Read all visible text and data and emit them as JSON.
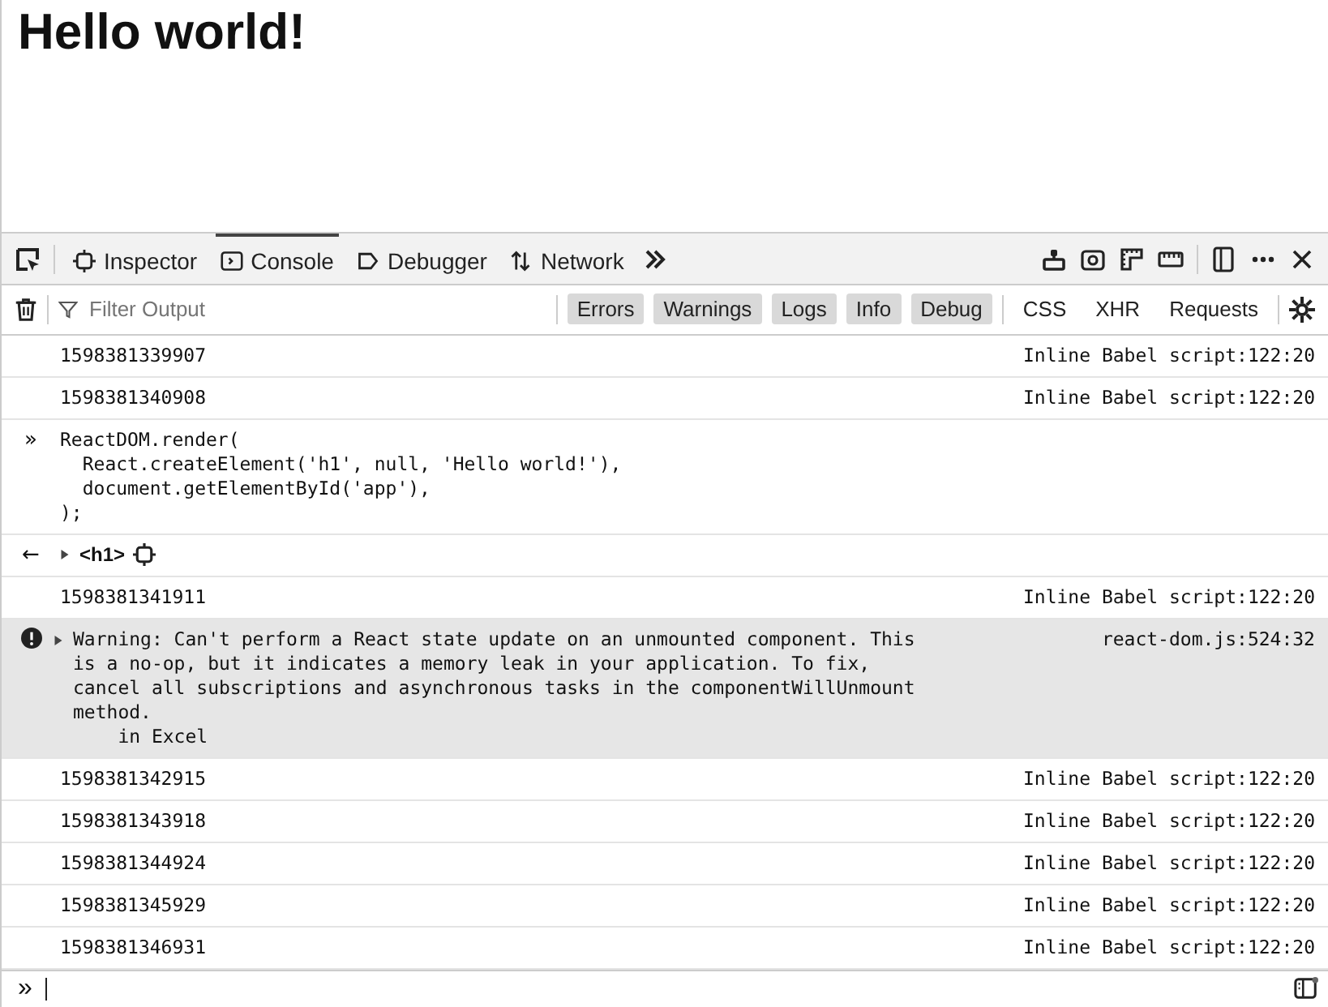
{
  "page": {
    "heading": "Hello world!"
  },
  "toolbar": {
    "tabs": [
      {
        "label": "Inspector",
        "selected": false
      },
      {
        "label": "Console",
        "selected": true
      },
      {
        "label": "Debugger",
        "selected": false
      },
      {
        "label": "Network",
        "selected": false
      }
    ]
  },
  "filter_bar": {
    "placeholder": "Filter Output",
    "levels": [
      {
        "label": "Errors",
        "selected": true
      },
      {
        "label": "Warnings",
        "selected": true
      },
      {
        "label": "Logs",
        "selected": true
      },
      {
        "label": "Info",
        "selected": true
      },
      {
        "label": "Debug",
        "selected": true
      }
    ],
    "types": [
      {
        "label": "CSS",
        "selected": false
      },
      {
        "label": "XHR",
        "selected": false
      },
      {
        "label": "Requests",
        "selected": false
      }
    ]
  },
  "entries": [
    {
      "kind": "log",
      "text": "1598381339907",
      "source": "Inline Babel script:122:20"
    },
    {
      "kind": "log",
      "text": "1598381340908",
      "source": "Inline Babel script:122:20"
    },
    {
      "kind": "input",
      "prompt": "»",
      "text": "ReactDOM.render(\n  React.createElement('h1', null, 'Hello world!'),\n  document.getElementById('app'),\n);"
    },
    {
      "kind": "result",
      "prompt": "←",
      "text": "<h1>"
    },
    {
      "kind": "log",
      "text": "1598381341911",
      "source": "Inline Babel script:122:20"
    },
    {
      "kind": "warning",
      "text": "Warning: Can't perform a React state update on an unmounted component. This\nis a no-op, but it indicates a memory leak in your application. To fix,\ncancel all subscriptions and asynchronous tasks in the componentWillUnmount\nmethod.\n    in Excel",
      "source": "react-dom.js:524:32"
    },
    {
      "kind": "log",
      "text": "1598381342915",
      "source": "Inline Babel script:122:20"
    },
    {
      "kind": "log",
      "text": "1598381343918",
      "source": "Inline Babel script:122:20"
    },
    {
      "kind": "log",
      "text": "1598381344924",
      "source": "Inline Babel script:122:20"
    },
    {
      "kind": "log",
      "text": "1598381345929",
      "source": "Inline Babel script:122:20"
    },
    {
      "kind": "log",
      "text": "1598381346931",
      "source": "Inline Babel script:122:20"
    }
  ],
  "input_line": {
    "prompt": "»"
  }
}
